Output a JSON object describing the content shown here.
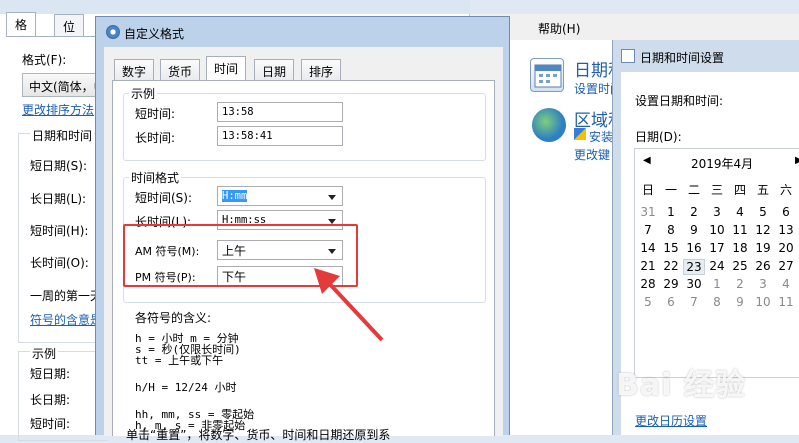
{
  "left_dialog": {
    "tabs": [
      "格式",
      "位置"
    ],
    "format_label": "格式(F):",
    "format_value": "中文(简体，中",
    "change_sort_link": "更改排序方法",
    "datetime_group": "日期和时间",
    "labels": [
      "短日期(S):",
      "长日期(L):",
      "短时间(H):",
      "长时间(O):",
      "一周的第一天"
    ],
    "symbol_link": "符号的含意是",
    "example_group": "示例",
    "example_labels": [
      "短日期:",
      "长日期:",
      "短时间:"
    ]
  },
  "menubar": {
    "help": "帮助(H)"
  },
  "control_panel": {
    "datetime_title": "日期和",
    "datetime_link": "设置时间",
    "region_title": "区域和",
    "region_link": "安装",
    "region_link2": "更改键"
  },
  "datetime_dialog": {
    "title": "日期和时间设置",
    "set_label": "设置日期和时间:",
    "date_label": "日期(D):",
    "month_label": "2019年4月",
    "weekdays": [
      "日",
      "一",
      "二",
      "三",
      "四",
      "五",
      "六"
    ],
    "weeks": [
      [
        "31",
        "1",
        "2",
        "3",
        "4",
        "5",
        "6"
      ],
      [
        "7",
        "8",
        "9",
        "10",
        "11",
        "12",
        "13"
      ],
      [
        "14",
        "15",
        "16",
        "17",
        "18",
        "19",
        "20"
      ],
      [
        "21",
        "22",
        "23",
        "24",
        "25",
        "26",
        "27"
      ],
      [
        "28",
        "29",
        "30",
        "1",
        "2",
        "3",
        "4"
      ],
      [
        "5",
        "6",
        "7",
        "8",
        "9",
        "10",
        "11"
      ]
    ],
    "calendar_link": "更改日历设置"
  },
  "customize_dialog": {
    "title": "自定义格式",
    "tabs": [
      "数字",
      "货币",
      "时间",
      "日期",
      "排序"
    ],
    "active_tab": "时间",
    "example_group": "示例",
    "short_time_label": "短时间:",
    "short_time_value": "13:58",
    "long_time_label": "长时间:",
    "long_time_value": "13:58:41",
    "format_group": "时间格式",
    "short_time_format_label": "短时间(S):",
    "short_time_format_value": "H:mm",
    "long_time_format_label": "长时间(L):",
    "long_time_format_value": "H:mm:ss",
    "am_label": "AM 符号(M):",
    "am_value": "上午",
    "pm_label": "PM 符号(P):",
    "pm_value": "下午",
    "meaning_title": "各符号的含义:",
    "help_lines": [
      "h = 小时   m = 分钟",
      "s = 秒(仅限长时间)",
      "tt = 上午或下午",
      "h/H = 12/24 小时",
      "hh, mm, ss = 零起始",
      "h, m, s = 非零起始"
    ],
    "footer_text": "单击“重置”，将数字、货币、时间和日期还原到系"
  },
  "watermark": "Bai 经验",
  "colors": {
    "highlight": "#e53a3a",
    "link": "#1a5fb4",
    "selection": "#3399ff"
  }
}
